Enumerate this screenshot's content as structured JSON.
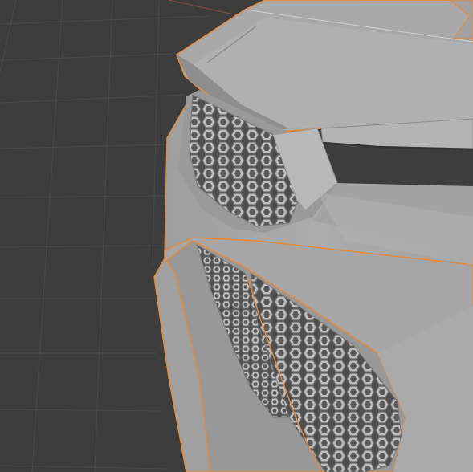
{
  "viewport": {
    "background_color": "#3d3d3d",
    "grid_line_color": "#4a4a4a",
    "grid_axis_color": "#8a4a4a",
    "selection_outline_color": "#e58a3a",
    "model_base_color": "#a8a8a8",
    "model_shadow_color": "#8f8f8f",
    "mesh_hole_color": "#5a5a5a",
    "mesh_cell_color": "#b9b9b9"
  }
}
